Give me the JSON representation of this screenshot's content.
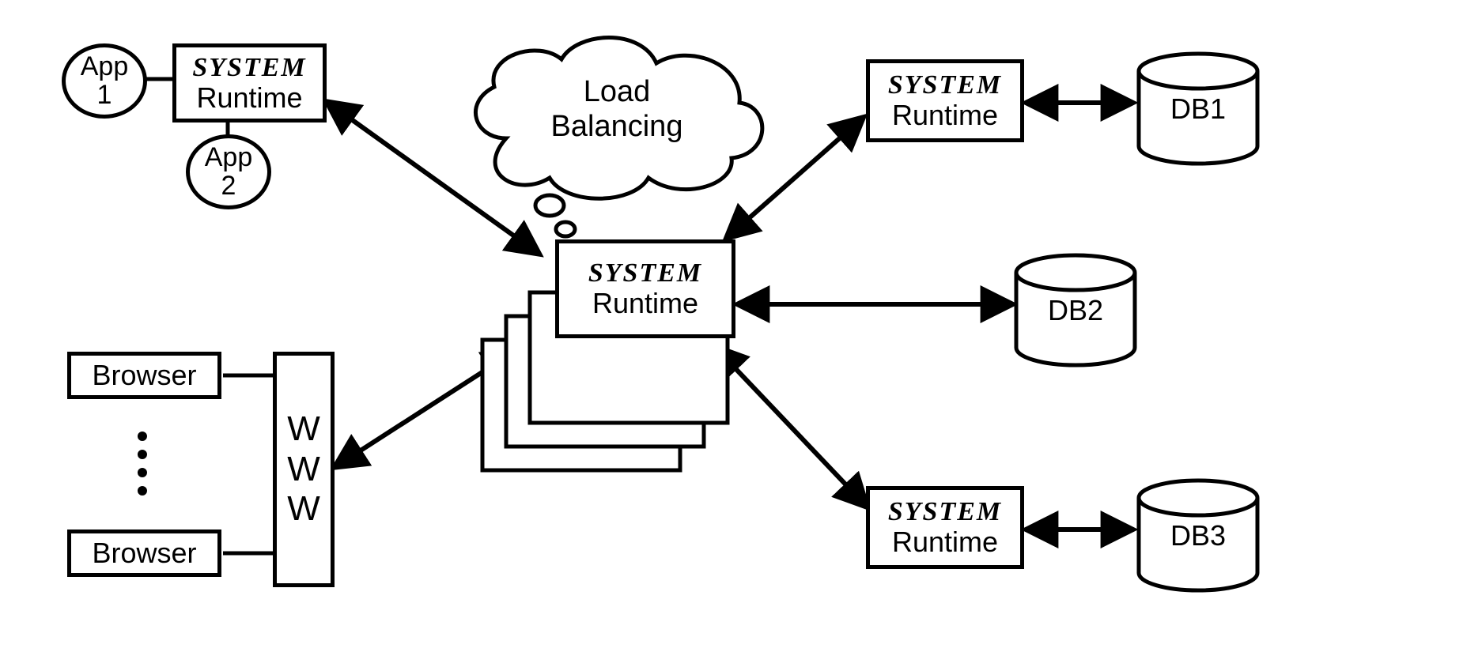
{
  "apps": {
    "app1": "App\n1",
    "app2": "App\n2"
  },
  "runtimes": {
    "system_word": "SYSTEM",
    "runtime_word": "Runtime"
  },
  "cloud": {
    "label": "Load\nBalancing"
  },
  "browsers": {
    "label": "Browser"
  },
  "www": {
    "label": "W\nW\nW"
  },
  "dbs": {
    "db1": "DB1",
    "db2": "DB2",
    "db3": "DB3"
  }
}
